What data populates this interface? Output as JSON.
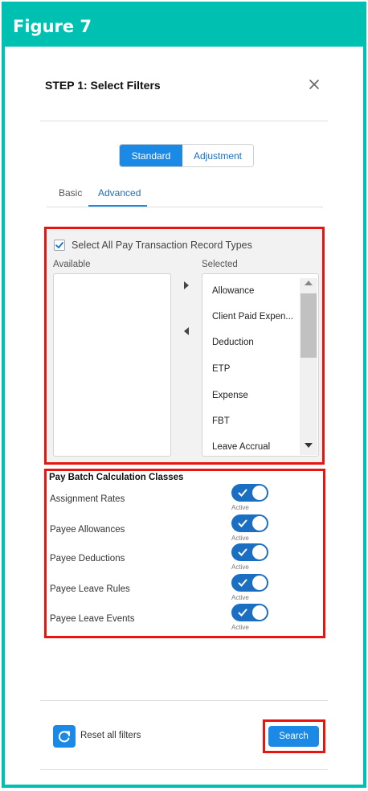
{
  "banner": {
    "title": "Figure 7"
  },
  "modal": {
    "title": "STEP 1: Select Filters"
  },
  "mode_toggle": {
    "standard": "Standard",
    "adjustment": "Adjustment",
    "selected": "Standard"
  },
  "tabs": [
    {
      "label": "Basic"
    },
    {
      "label": "Advanced",
      "active": true
    }
  ],
  "record_types": {
    "select_all_label": "Select All Pay Transaction Record Types",
    "select_all_checked": true,
    "available_label": "Available",
    "selected_label": "Selected",
    "selected_items": [
      "Allowance",
      "Client Paid Expen...",
      "Deduction",
      "ETP",
      "Expense",
      "FBT",
      "Leave Accrual"
    ]
  },
  "calc_classes": {
    "title": "Pay Batch Calculation Classes",
    "rows": [
      {
        "label": "Assignment Rates",
        "status": "Active"
      },
      {
        "label": "Payee Allowances",
        "status": "Active"
      },
      {
        "label": "Payee Deductions",
        "status": "Active"
      },
      {
        "label": "Payee Leave Rules",
        "status": "Active"
      },
      {
        "label": "Payee Leave Events",
        "status": "Active"
      }
    ]
  },
  "footer": {
    "reset_label": "Reset all filters",
    "search_label": "Search"
  },
  "colors": {
    "banner": "#00c1b1",
    "brand_blue": "#1b8ae6",
    "toggle_blue": "#1b6fc2",
    "highlight_red": "#e8140d"
  }
}
